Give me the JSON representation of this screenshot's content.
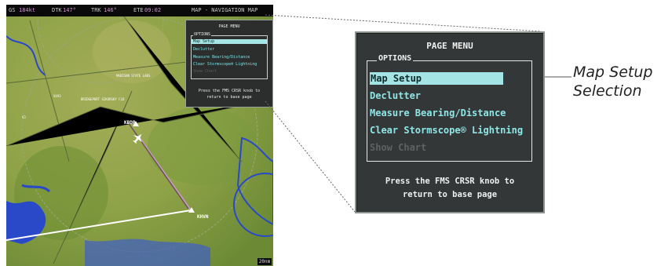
{
  "mfd": {
    "status_bar": {
      "gs_label": "GS",
      "gs_value": "184kt",
      "dtk_label": "DTK",
      "dtk_value": "147°",
      "trk_label": "TRK",
      "trk_value": "146°",
      "eta_label": "ETE",
      "eta_value": "09:02",
      "page_name": "MAP - NAVIGATION MAP"
    },
    "mini_menu": {
      "title": "PAGE MENU",
      "options_label": "OPTIONS",
      "items": [
        "Map Setup",
        "Declutter",
        "Measure Bearing/Distance",
        "Clear Stormscope® Lightning",
        "Show Chart"
      ],
      "footer_line1": "Press the FMS CRSR knob to",
      "footer_line2": "return to base page"
    },
    "map_labels": [
      "KBDR",
      "KHVN",
      "MADISON STATE LABS",
      "BRIDGEPORT SIKORSKY FLD"
    ],
    "scale_value": "20nm",
    "colors": {
      "terrain": "#7f9a3e",
      "water": "#2a49c9",
      "route": "#ffffff"
    }
  },
  "page_menu": {
    "title": "PAGE MENU",
    "options_label": "OPTIONS",
    "items": [
      {
        "label": "Map Setup",
        "state": "selected"
      },
      {
        "label": "Declutter",
        "state": "enabled"
      },
      {
        "label": "Measure Bearing/Distance",
        "state": "enabled"
      },
      {
        "label": "Clear Stormscope® Lightning",
        "state": "enabled"
      },
      {
        "label": "Show Chart",
        "state": "disabled"
      }
    ],
    "footer_line1": "Press the FMS CRSR knob to",
    "footer_line2": "return to base page",
    "colors": {
      "selected_bg": "#a5e4e4",
      "item_text": "#8fe6e6",
      "panel_bg": "#343737"
    }
  },
  "callout": {
    "line1": "Map Setup",
    "line2": "Selection"
  }
}
